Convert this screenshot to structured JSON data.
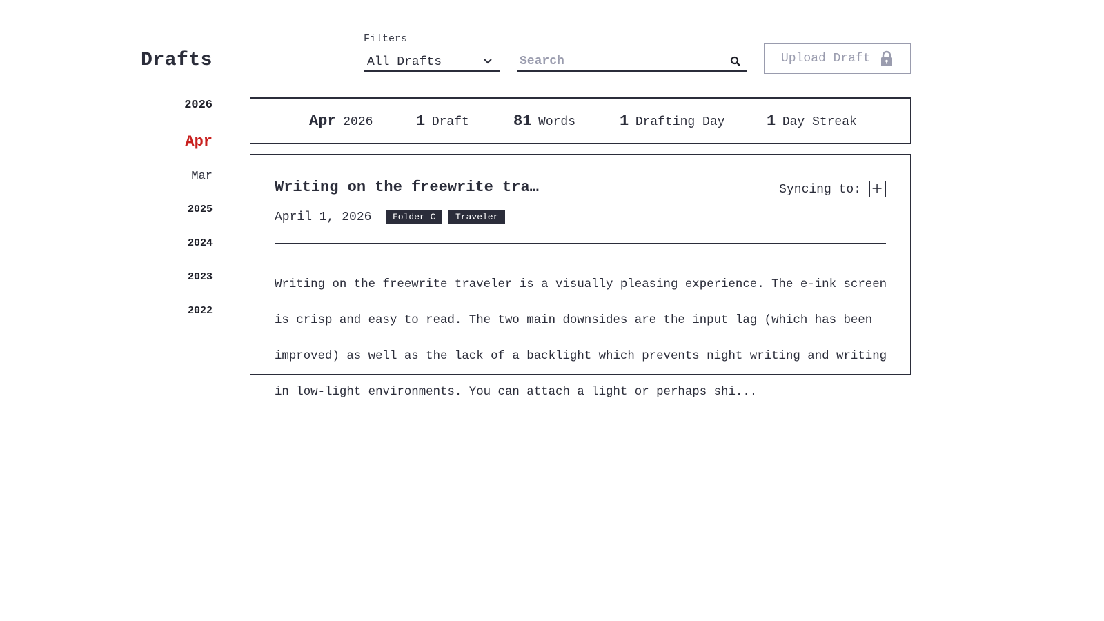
{
  "header": {
    "title": "Drafts",
    "filters_label": "Filters",
    "filter_value": "All Drafts",
    "search_placeholder": "Search",
    "upload_label": "Upload Draft"
  },
  "timeline": {
    "year_current": "2026",
    "month_selected": "Apr",
    "month_other": "Mar",
    "years": [
      "2025",
      "2024",
      "2023",
      "2022"
    ]
  },
  "stats": {
    "month": "Apr",
    "year": "2026",
    "drafts_count": "1",
    "drafts_label": "Draft",
    "words_count": "81",
    "words_label": "Words",
    "days_count": "1",
    "days_label": "Drafting Day",
    "streak_count": "1",
    "streak_label": "Day Streak"
  },
  "draft": {
    "title": "Writing on the freewrite tra…",
    "sync_label": "Syncing to:",
    "date": "April 1, 2026",
    "tags": [
      "Folder C",
      "Traveler"
    ],
    "excerpt_lines": [
      "Writing on the freewrite traveler is a visually pleasing experience. The e-ink screen",
      "is crisp and easy to read. The two main downsides are the input lag (which has been",
      "improved) as well as the lack of a backlight which prevents night writing and writing",
      "in low-light environments. You can attach a light or perhaps shi..."
    ]
  },
  "colors": {
    "text": "#2b2d3a",
    "accent_red": "#c8201e",
    "muted": "#9a9cae",
    "tag_bg": "#2b2d3a"
  }
}
